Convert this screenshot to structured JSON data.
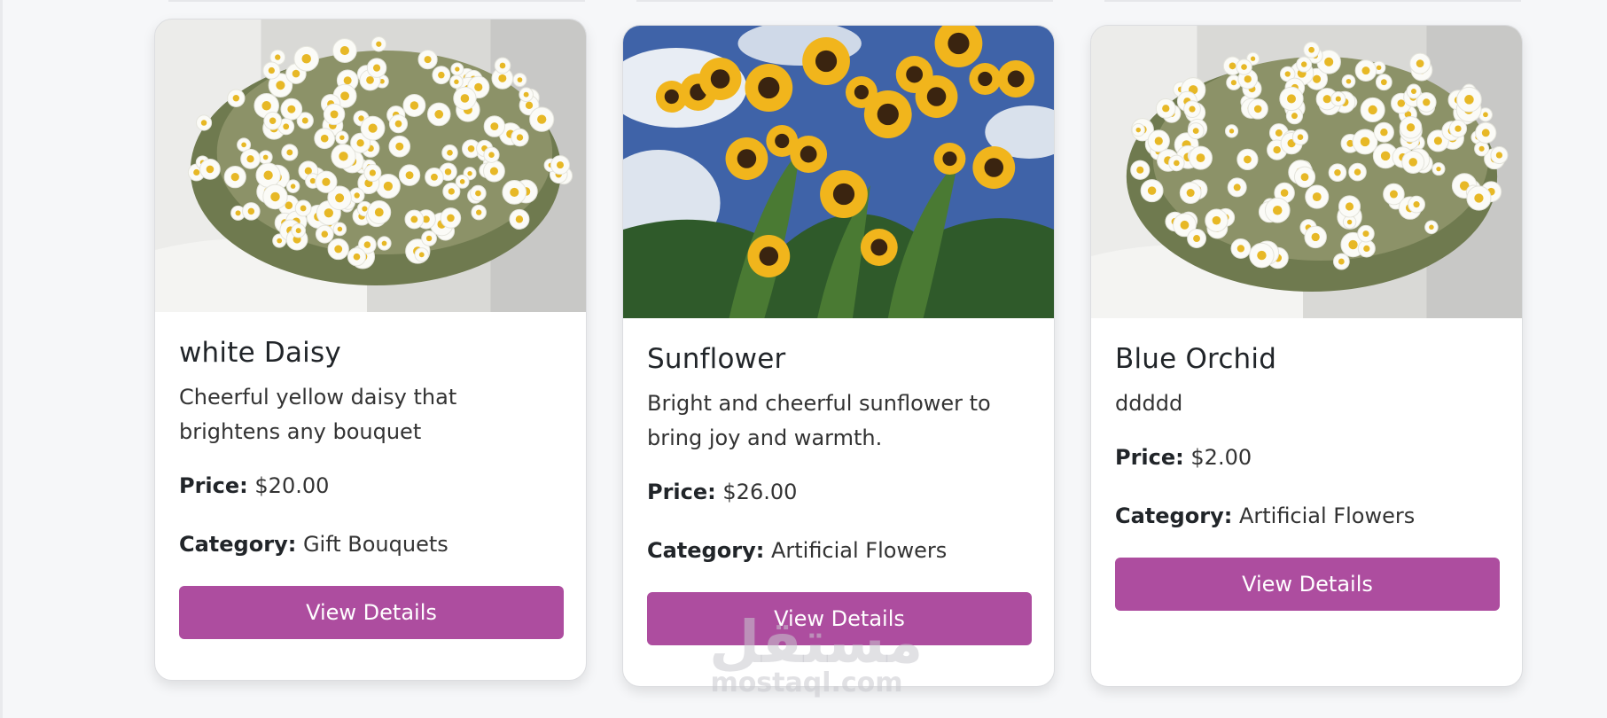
{
  "products": [
    {
      "title": "white Daisy",
      "description": "Cheerful yellow daisy that brightens any bouquet",
      "price_label": "Price:",
      "price_value": "$20.00",
      "category_label": "Category:",
      "category_value": "Gift Bouquets",
      "button_label": "View Details",
      "image": "white-daisy-bouquet"
    },
    {
      "title": "Sunflower",
      "description": "Bright and cheerful sunflower to bring joy and warmth.",
      "price_label": "Price:",
      "price_value": "$26.00",
      "category_label": "Category:",
      "category_value": "Artificial Flowers",
      "button_label": "View Details",
      "image": "sunflowers-blue-sky"
    },
    {
      "title": "Blue Orchid",
      "description": "ddddd",
      "price_label": "Price:",
      "price_value": "$2.00",
      "category_label": "Category:",
      "category_value": "Artificial Flowers",
      "button_label": "View Details",
      "image": "white-daisy-bouquet"
    }
  ],
  "watermark": {
    "arabic": "مستقل",
    "latin": "mostaql.com"
  },
  "colors": {
    "button": "#ad4d9f",
    "page_background": "#f6f7f9",
    "card_background": "#ffffff"
  }
}
